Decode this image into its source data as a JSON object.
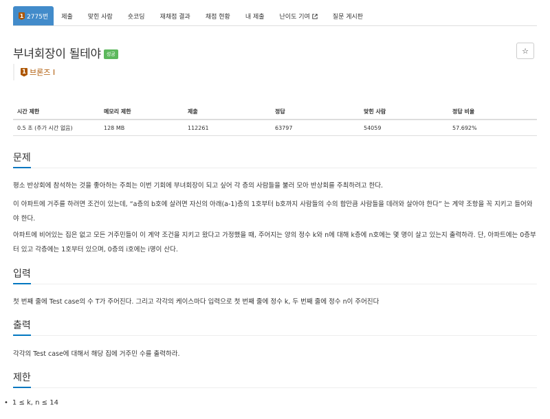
{
  "nav": {
    "tabs": [
      {
        "label": "2775번",
        "active": true,
        "tier": "1"
      },
      {
        "label": "제출"
      },
      {
        "label": "맞힌 사람"
      },
      {
        "label": "숏코딩"
      },
      {
        "label": "재채점 결과"
      },
      {
        "label": "채점 현황"
      },
      {
        "label": "내 제출"
      },
      {
        "label": "난이도 기여",
        "external": true
      },
      {
        "label": "질문 게시판"
      }
    ]
  },
  "problem": {
    "title": "부녀회장이 될테야",
    "status_label": "성공",
    "star_icon": "☆",
    "tier_number": "1",
    "tier_text": "브론즈 I"
  },
  "info_table": {
    "headers": [
      "시간 제한",
      "메모리 제한",
      "제출",
      "정답",
      "맞힌 사람",
      "정답 비율"
    ],
    "values": [
      "0.5 초 (추가 시간 없음)",
      "128 MB",
      "112261",
      "63797",
      "54059",
      "57.692%"
    ]
  },
  "sections": {
    "description": {
      "title": "문제",
      "p1": "평소 반상회에 참석하는 것을 좋아하는 주희는 이번 기회에 부녀회장이 되고 싶어 각 층의 사람들을 불러 모아 반상회를 주최하려고 한다.",
      "p2": "이 아파트에 거주를 하려면 조건이 있는데, “a층의 b호에 살려면 자신의 아래(a-1)층의 1호부터 b호까지 사람들의 수의 합만큼 사람들을 데려와 살아야 한다” 는 계약 조항을 꼭 지키고 들어와야 한다.",
      "p3": "아파트에 비어있는 집은 없고 모든 거주민들이 이 계약 조건을 지키고 왔다고 가정했을 때, 주어지는 양의 정수 k와 n에 대해 k층에 n호에는 몇 명이 살고 있는지 출력하라. 단, 아파트에는 0층부터 있고 각층에는 1호부터 있으며, 0층의 i호에는 i명이 산다."
    },
    "input": {
      "title": "입력",
      "text": "첫 번째 줄에 Test case의 수 T가 주어진다. 그리고 각각의 케이스마다 입력으로 첫 번째 줄에 정수 k, 두 번째 줄에 정수 n이 주어진다"
    },
    "output": {
      "title": "출력",
      "text": "각각의 Test case에 대해서 해당 집에 거주민 수를 출력하라."
    },
    "limit": {
      "title": "제한",
      "bullet": "•",
      "item": "1 ≤ k, n ≤ 14"
    }
  },
  "colors": {
    "active_tab": "#428bca",
    "success": "#5cb85c",
    "bronze": "#ad5600",
    "section_underline": "#0076c0"
  }
}
